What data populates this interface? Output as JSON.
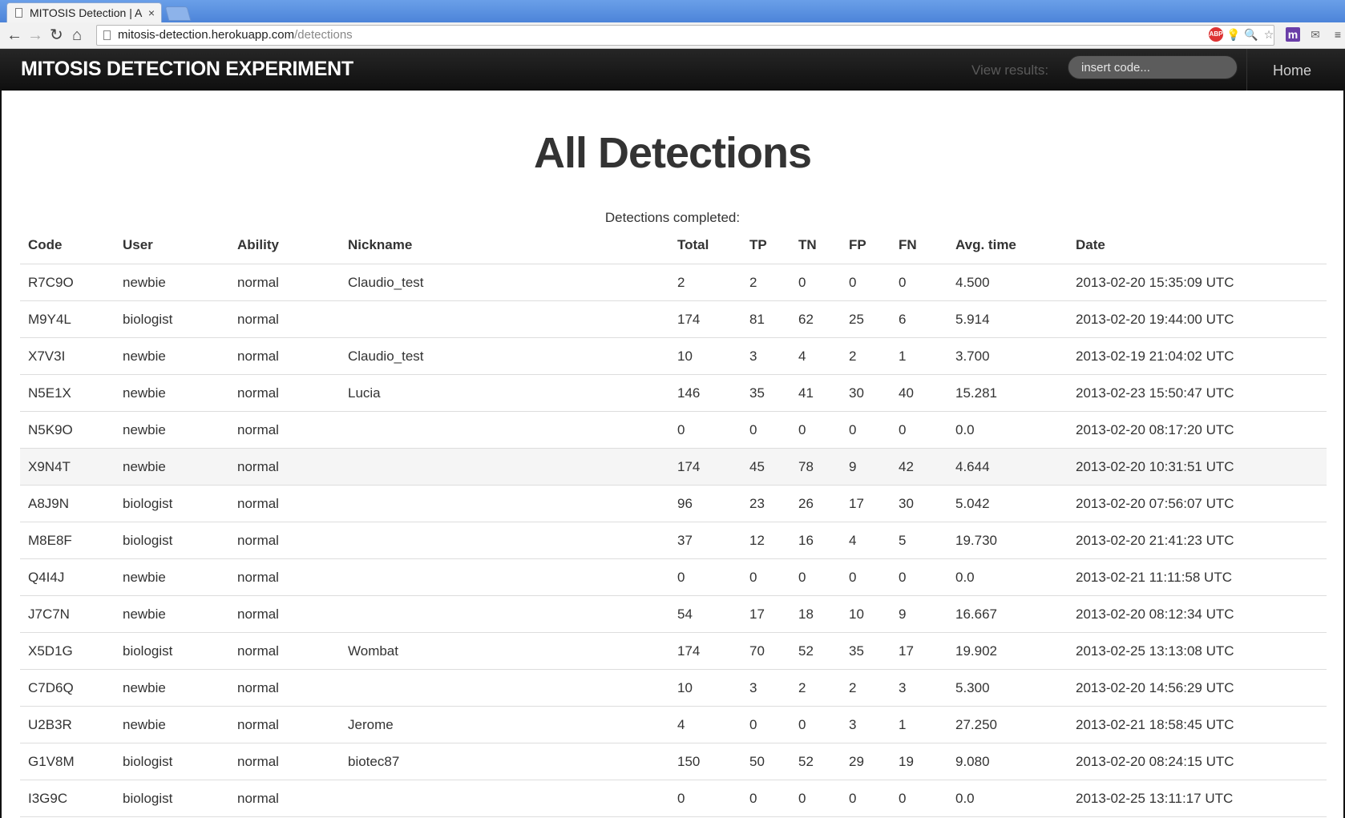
{
  "browser": {
    "tab_title": "MITOSIS Detection | A",
    "tab_close": "×",
    "url_host": "mitosis-detection.herokuapp.com",
    "url_path": "/detections",
    "back_glyph": "←",
    "forward_glyph": "→",
    "reload_glyph": "↻",
    "home_glyph": "⌂",
    "ext_abp": "ABP",
    "ext_bulb": "💡",
    "ext_zoom": "🔍",
    "ext_star": "☆",
    "ext_m": "m",
    "ext_mail": "✉",
    "ext_menu": "≡"
  },
  "navbar": {
    "brand": "MITOSIS DETECTION EXPERIMENT",
    "view_results_label": "View results:",
    "code_placeholder": "insert code...",
    "home_link": "Home"
  },
  "main": {
    "title": "All Detections",
    "caption": "Detections completed:",
    "columns": [
      "Code",
      "User",
      "Ability",
      "Nickname",
      "Total",
      "TP",
      "TN",
      "FP",
      "FN",
      "Avg. time",
      "Date"
    ],
    "rows": [
      [
        "R7C9O",
        "newbie",
        "normal",
        "Claudio_test",
        "2",
        "2",
        "0",
        "0",
        "0",
        "4.500",
        "2013-02-20 15:35:09 UTC"
      ],
      [
        "M9Y4L",
        "biologist",
        "normal",
        "",
        "174",
        "81",
        "62",
        "25",
        "6",
        "5.914",
        "2013-02-20 19:44:00 UTC"
      ],
      [
        "X7V3I",
        "newbie",
        "normal",
        "Claudio_test",
        "10",
        "3",
        "4",
        "2",
        "1",
        "3.700",
        "2013-02-19 21:04:02 UTC"
      ],
      [
        "N5E1X",
        "newbie",
        "normal",
        "Lucia",
        "146",
        "35",
        "41",
        "30",
        "40",
        "15.281",
        "2013-02-23 15:50:47 UTC"
      ],
      [
        "N5K9O",
        "newbie",
        "normal",
        "",
        "0",
        "0",
        "0",
        "0",
        "0",
        "0.0",
        "2013-02-20 08:17:20 UTC"
      ],
      [
        "X9N4T",
        "newbie",
        "normal",
        "",
        "174",
        "45",
        "78",
        "9",
        "42",
        "4.644",
        "2013-02-20 10:31:51 UTC"
      ],
      [
        "A8J9N",
        "biologist",
        "normal",
        "",
        "96",
        "23",
        "26",
        "17",
        "30",
        "5.042",
        "2013-02-20 07:56:07 UTC"
      ],
      [
        "M8E8F",
        "biologist",
        "normal",
        "",
        "37",
        "12",
        "16",
        "4",
        "5",
        "19.730",
        "2013-02-20 21:41:23 UTC"
      ],
      [
        "Q4I4J",
        "newbie",
        "normal",
        "",
        "0",
        "0",
        "0",
        "0",
        "0",
        "0.0",
        "2013-02-21 11:11:58 UTC"
      ],
      [
        "J7C7N",
        "newbie",
        "normal",
        "",
        "54",
        "17",
        "18",
        "10",
        "9",
        "16.667",
        "2013-02-20 08:12:34 UTC"
      ],
      [
        "X5D1G",
        "biologist",
        "normal",
        "Wombat",
        "174",
        "70",
        "52",
        "35",
        "17",
        "19.902",
        "2013-02-25 13:13:08 UTC"
      ],
      [
        "C7D6Q",
        "newbie",
        "normal",
        "",
        "10",
        "3",
        "2",
        "2",
        "3",
        "5.300",
        "2013-02-20 14:56:29 UTC"
      ],
      [
        "U2B3R",
        "newbie",
        "normal",
        "Jerome",
        "4",
        "0",
        "0",
        "3",
        "1",
        "27.250",
        "2013-02-21 18:58:45 UTC"
      ],
      [
        "G1V8M",
        "biologist",
        "normal",
        "biotec87",
        "150",
        "50",
        "52",
        "29",
        "19",
        "9.080",
        "2013-02-20 08:24:15 UTC"
      ],
      [
        "I3G9C",
        "biologist",
        "normal",
        "",
        "0",
        "0",
        "0",
        "0",
        "0",
        "0.0",
        "2013-02-25 13:11:17 UTC"
      ]
    ],
    "highlighted_row": 5
  }
}
